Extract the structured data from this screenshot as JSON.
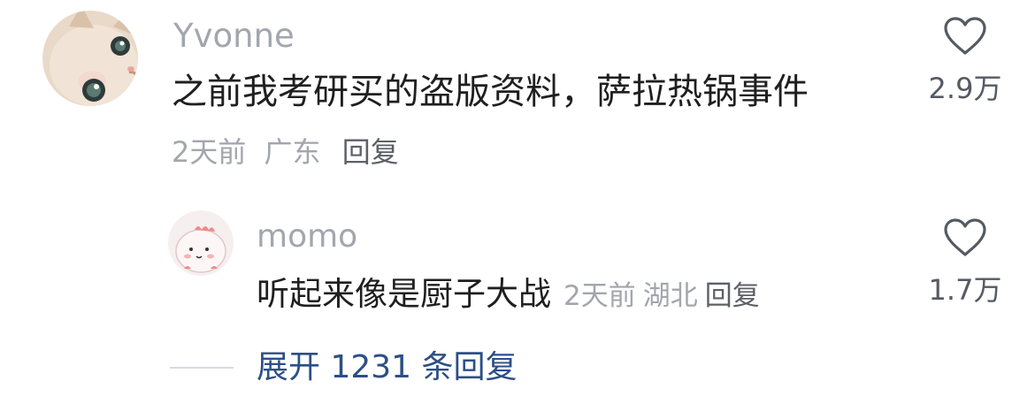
{
  "comment": {
    "username": "Yvonne",
    "text": "之前我考研买的盗版资料，萨拉热锅事件",
    "time": "2天前",
    "location": "广东",
    "reply_label": "回复",
    "like_count": "2.9万",
    "avatar_icon": "kitten-avatar-icon"
  },
  "reply": {
    "username": "momo",
    "text": "听起来像是厨子大战",
    "time": "2天前",
    "location": "湖北",
    "reply_label": "回复",
    "like_count": "1.7万",
    "avatar_icon": "cartoon-dinosaur-avatar-icon"
  },
  "expand": {
    "label": "展开 1231 条回复"
  },
  "colors": {
    "username": "#a3a6ad",
    "text": "#1f1f1f",
    "meta": "#a3a6ad",
    "reply_button": "#5d6068",
    "link": "#2c4f86",
    "heart_outline": "#555a62"
  }
}
